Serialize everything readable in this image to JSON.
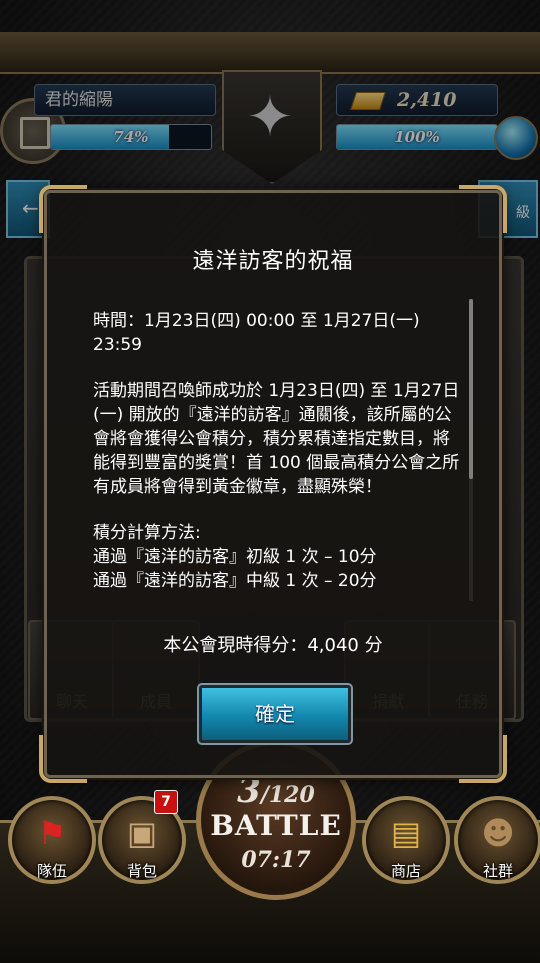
{
  "hud": {
    "player_name": "君的縮陽",
    "gold": "2,410",
    "exp_percent_label": "74%",
    "exp_fraction": 0.74,
    "stamina_percent_label": "100%",
    "stamina_fraction": 1.0
  },
  "background": {
    "nav_items": [
      "聊天",
      "成員",
      "捐獻",
      "任務"
    ],
    "tab_right_label": "級"
  },
  "dialog": {
    "title": "遠洋訪客的祝福",
    "paragraphs": [
      "時間：1月23日(四) 00:00 至 1月27日(一) 23:59",
      "活動期間召喚師成功於 1月23日(四) 至 1月27日(一) 開放的『遠洋的訪客』通關後，該所屬的公會將會獲得公會積分，積分累積達指定數目，將能得到豐富的獎賞！首 100 個最高積分公會之所有成員將會得到黃金徽章，盡顯殊榮！",
      "積分計算方法:\n通過『遠洋的訪客』初級 1 次 – 10分\n通過『遠洋的訪客』中級 1 次 – 20分"
    ],
    "score_text": "本公會現時得分：4,040 分",
    "confirm_label": "確定"
  },
  "bottom_nav": {
    "team_label": "隊伍",
    "bag_label": "背包",
    "bag_badge": "7",
    "shop_label": "商店",
    "social_label": "社群",
    "battle_current": "3",
    "battle_max": "/120",
    "battle_title": "BATTLE",
    "battle_timer": "07:17"
  }
}
